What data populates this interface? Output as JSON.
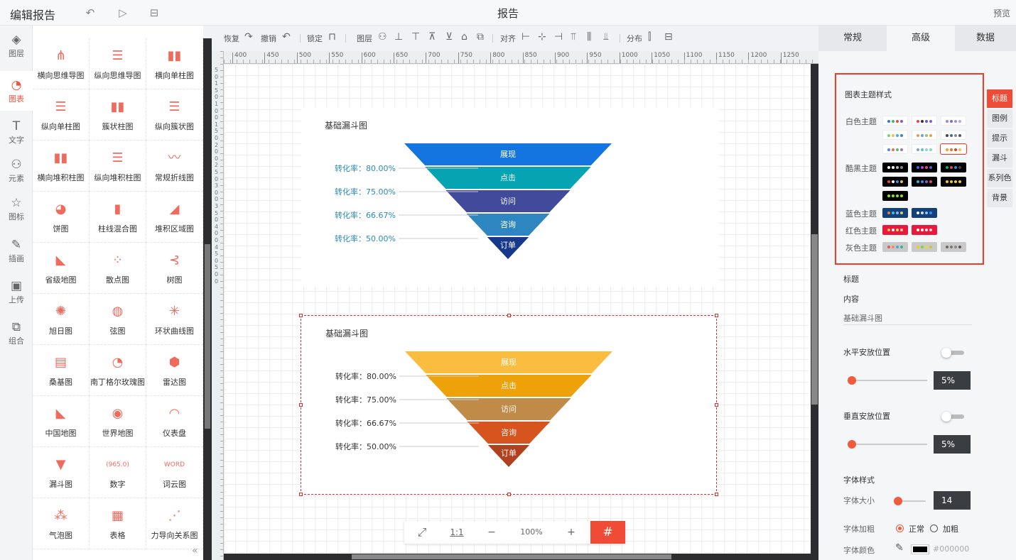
{
  "app": {
    "title": "编辑报告",
    "page_title": "报告",
    "preview_label": "预览"
  },
  "nav": [
    {
      "label": "图层",
      "icon": "layers-icon",
      "glyph": "◈"
    },
    {
      "label": "图表",
      "icon": "chart-pie-icon",
      "glyph": "◔"
    },
    {
      "label": "文字",
      "icon": "text-icon",
      "glyph": "T"
    },
    {
      "label": "元素",
      "icon": "shapes-icon",
      "glyph": "⚇"
    },
    {
      "label": "图标",
      "icon": "star-icon",
      "glyph": "☆"
    },
    {
      "label": "插画",
      "icon": "palette-icon",
      "glyph": "✎"
    },
    {
      "label": "上传",
      "icon": "upload-image-icon",
      "glyph": "▣"
    },
    {
      "label": "组合",
      "icon": "group-icon",
      "glyph": "⧉"
    }
  ],
  "components": [
    {
      "label": "横向思维导图",
      "icon": "horizontal-mindmap-icon",
      "glyph": "⋔"
    },
    {
      "label": "纵向思维导图",
      "icon": "vertical-mindmap-icon",
      "glyph": "☰"
    },
    {
      "label": "横向单柱图",
      "icon": "column-chart-icon",
      "glyph": "▮▮"
    },
    {
      "label": "纵向单柱图",
      "icon": "bar-chart-icon",
      "glyph": "☰"
    },
    {
      "label": "簇状柱图",
      "icon": "clustered-column-icon",
      "glyph": "▮▮"
    },
    {
      "label": "纵向簇状图",
      "icon": "clustered-bar-icon",
      "glyph": "☰"
    },
    {
      "label": "横向堆积柱图",
      "icon": "stacked-column-icon",
      "glyph": "▮▮"
    },
    {
      "label": "纵向堆积柱图",
      "icon": "stacked-bar-icon",
      "glyph": "☰"
    },
    {
      "label": "常规折线图",
      "icon": "line-chart-icon",
      "glyph": "〰"
    },
    {
      "label": "饼图",
      "icon": "pie-chart-icon",
      "glyph": "◕"
    },
    {
      "label": "柱线混合图",
      "icon": "bar-line-icon",
      "glyph": "▮"
    },
    {
      "label": "堆积区域图",
      "icon": "area-chart-icon",
      "glyph": "◢"
    },
    {
      "label": "省级地图",
      "icon": "province-map-icon",
      "glyph": "◣"
    },
    {
      "label": "散点图",
      "icon": "scatter-icon",
      "glyph": "⁘"
    },
    {
      "label": "树图",
      "icon": "tree-icon",
      "glyph": "⊰"
    },
    {
      "label": "旭日图",
      "icon": "sunburst-icon",
      "glyph": "✺"
    },
    {
      "label": "弦图",
      "icon": "chord-icon",
      "glyph": "◍"
    },
    {
      "label": "环状曲线图",
      "icon": "radial-curve-icon",
      "glyph": "✳"
    },
    {
      "label": "桑基图",
      "icon": "sankey-icon",
      "glyph": "▤"
    },
    {
      "label": "南丁格尔玫瑰图",
      "icon": "nightingale-rose-icon",
      "glyph": "◔"
    },
    {
      "label": "雷达图",
      "icon": "radar-icon",
      "glyph": "⬢"
    },
    {
      "label": "中国地图",
      "icon": "china-map-icon",
      "glyph": "◣"
    },
    {
      "label": "世界地图",
      "icon": "globe-icon",
      "glyph": "◉"
    },
    {
      "label": "仪表盘",
      "icon": "gauge-icon",
      "glyph": "◠"
    },
    {
      "label": "漏斗图",
      "icon": "funnel-icon",
      "glyph": "▼"
    },
    {
      "label": "数字",
      "icon": "number-icon",
      "glyph": "(965.0)"
    },
    {
      "label": "词云图",
      "icon": "word-cloud-icon",
      "glyph": "WORD"
    },
    {
      "label": "气泡图",
      "icon": "bubble-icon",
      "glyph": "⁂"
    },
    {
      "label": "表格",
      "icon": "table-icon",
      "glyph": "▦"
    },
    {
      "label": "力导向关系图",
      "icon": "force-graph-icon",
      "glyph": "⋰"
    }
  ],
  "toolbar": {
    "redo": "恢复",
    "undo": "撤销",
    "lock": "锁定",
    "layer": "图层",
    "align": "对齐",
    "distribute": "分布"
  },
  "ruler": [
    "400",
    "450",
    "500",
    "550",
    "600",
    "650",
    "700",
    "750",
    "800",
    "850",
    "900",
    "950",
    "1000",
    "1050",
    "1100",
    "1150",
    "1200",
    "1250"
  ],
  "ruler_v": [
    "5",
    "0",
    "1",
    "5",
    "0",
    "1",
    "0",
    "0",
    "1",
    "5",
    "0",
    "2",
    "0",
    "0",
    "2",
    "5",
    "0",
    "3",
    "0",
    "0",
    "3",
    "5",
    "0",
    "4",
    "0",
    "0",
    "4",
    "5",
    "0",
    "5",
    "0",
    "0"
  ],
  "zoom": {
    "fit_label": "⤢",
    "ratio_label": "1:1",
    "minus": "−",
    "level": "100%",
    "plus": "+",
    "grid": "#"
  },
  "chart_data": [
    {
      "type": "funnel",
      "title": "基础漏斗图",
      "stages": [
        "展现",
        "点击",
        "访问",
        "咨询",
        "订单"
      ],
      "values": [
        100,
        80,
        60,
        40,
        20
      ],
      "conversion_labels": [
        "转化率：80.00%",
        "转化率：75.00%",
        "转化率：66.67%",
        "转化率：50.00%"
      ],
      "colors": [
        "#1474e0",
        "#06a3b3",
        "#424a9b",
        "#2e86c1",
        "#17398b"
      ],
      "label_color": "#2a8ab8"
    },
    {
      "type": "funnel",
      "title": "基础漏斗图",
      "stages": [
        "展现",
        "点击",
        "访问",
        "咨询",
        "订单"
      ],
      "values": [
        100,
        80,
        60,
        40,
        20
      ],
      "conversion_labels": [
        "转化率：80.00%",
        "转化率：75.00%",
        "转化率：66.67%",
        "转化率：50.00%"
      ],
      "colors": [
        "#fbbd3f",
        "#eda209",
        "#c08a48",
        "#d8541f",
        "#b0411f"
      ],
      "label_color": "#333333"
    }
  ],
  "right_tabs": [
    "常规",
    "高级",
    "数据"
  ],
  "theme": {
    "heading": "图表主题样式",
    "groups": [
      {
        "label": "白色主题",
        "rows": [
          [
            {
              "bg": "#ffffff",
              "dots": [
                "#2e7bd6",
                "#4cb15a",
                "#ef4d3c",
                "#7b5cd6"
              ]
            },
            {
              "bg": "#ffffff",
              "dots": [
                "#e2474c",
                "#333",
                "#5a5fc7",
                "#8a5ad3"
              ]
            },
            {
              "bg": "#ffffff",
              "dots": [
                "#9b8ad0",
                "#7a6cc9",
                "#a58de0",
                "#b9a8e6"
              ]
            }
          ],
          [
            {
              "bg": "#ffffff",
              "dots": [
                "#7bd360",
                "#f2c144",
                "#2fb5e8",
                "#3e7de0"
              ]
            },
            {
              "bg": "#ffffff",
              "dots": [
                "#f2944b",
                "#5aa7e0",
                "#9cc36a",
                "#e6a23c"
              ]
            },
            {
              "bg": "#ffffff",
              "dots": [
                "#444",
                "#2f6f93",
                "#888",
                "#555"
              ]
            }
          ],
          [
            {
              "bg": "#ffffff",
              "dots": [
                "#4c8ad8",
                "#e46a5f",
                "#5cb87a",
                "#9c6bd1"
              ]
            },
            {
              "bg": "#ffffff",
              "dots": [
                "#7e9bd8",
                "#5cc0d2",
                "#a0c4f0",
                "#88d6b6"
              ]
            },
            {
              "bg": "#ffffff",
              "dots": [
                "#f0a21f",
                "#e8722c",
                "#d9451f",
                "#f5c342"
              ],
              "selected": true
            }
          ]
        ]
      },
      {
        "label": "酷黑主题",
        "rows": [
          [
            {
              "bg": "#000000",
              "dots": [
                "#ffffff",
                "#ffffff",
                "#bbbbbb",
                "#888888"
              ]
            },
            {
              "bg": "#000000",
              "dots": [
                "#3d6fe0",
                "#c040d0",
                "#e04a7a",
                "#5a5ad8"
              ]
            },
            {
              "bg": "#000000",
              "dots": [
                "#1fa86b",
                "#e24a3a",
                "#2f8cde",
                "#444444"
              ]
            }
          ],
          [
            {
              "bg": "#000000",
              "dots": [
                "#f04b36",
                "#ffffff",
                "#3e8fe0",
                "#f2c144"
              ]
            },
            {
              "bg": "#000000",
              "dots": [
                "#2fb5e8",
                "#5a7de0",
                "#8a5ad3",
                "#e24a6a"
              ]
            },
            {
              "bg": "#000000",
              "dots": [
                "#f2c930",
                "#f2c930",
                "#f2c930",
                "#f2c930"
              ]
            }
          ],
          [
            {
              "bg": "#000000",
              "dots": [
                "#8ae62a",
                "#8ae62a",
                "#8ae62a",
                "#8ae62a"
              ]
            }
          ]
        ]
      },
      {
        "label": "蓝色主题",
        "rows": [
          [
            {
              "bg": "#12407a",
              "dots": [
                "#f07a3a",
                "#3ec0e8",
                "#8fb3e6",
                "#e8d05a"
              ]
            },
            {
              "bg": "#12407a",
              "dots": [
                "#ffffff",
                "#cfe3f7",
                "#8fc2f0",
                "#3e8fe0"
              ]
            }
          ]
        ]
      },
      {
        "label": "红色主题",
        "rows": [
          [
            {
              "bg": "#e8193c",
              "dots": [
                "#f2c144",
                "#ffffff",
                "#f5e06a",
                "#ffd0a0"
              ]
            },
            {
              "bg": "#e8193c",
              "dots": [
                "#ffffff",
                "#ffffff",
                "#ffe3e3",
                "#ffd2d2"
              ]
            }
          ]
        ]
      },
      {
        "label": "灰色主题",
        "rows": [
          [
            {
              "bg": "#c9c9c9",
              "dots": [
                "#e65a4a",
                "#f08a6a",
                "#5aa0d8",
                "#3bb28a"
              ]
            },
            {
              "bg": "#c9c9c9",
              "dots": [
                "#f2c930",
                "#8ad03a",
                "#e6d840",
                "#c8c83a"
              ]
            },
            {
              "bg": "#c9c9c9",
              "dots": [
                "#666666",
                "#777777",
                "#888888",
                "#555555"
              ]
            }
          ]
        ]
      }
    ]
  },
  "side_tabs": [
    "标题",
    "图例",
    "提示",
    "漏斗",
    "系列色",
    "背景"
  ],
  "settings": {
    "title_label": "标题",
    "content_label": "内容",
    "content_value": "基础漏斗图",
    "h_position_label": "水平安放位置",
    "h_position_value": "5%",
    "v_position_label": "垂直安放位置",
    "v_position_value": "5%",
    "font_style_label": "字体样式",
    "font_size_label": "字体大小",
    "font_size_value": "14",
    "font_weight_label": "字体加粗",
    "weight_normal": "正常",
    "weight_bold": "加粗",
    "font_color_label": "字体颜色",
    "font_color_value": "#000000",
    "h_slider_level": 0.05,
    "v_slider_level": 0.05,
    "size_slider_level": 0.07
  }
}
